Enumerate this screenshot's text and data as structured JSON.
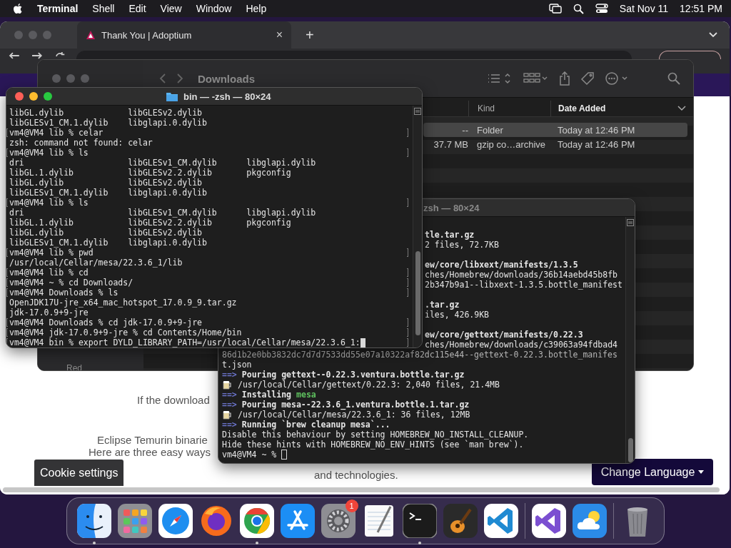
{
  "menubar": {
    "app": "Terminal",
    "menus": [
      "Shell",
      "Edit",
      "View",
      "Window",
      "Help"
    ],
    "date": "Sat Nov 11",
    "time": "12:51 PM"
  },
  "browser": {
    "tab": {
      "title": "Thank You | Adoptium",
      "close": "×",
      "selected": true
    },
    "new_tab": "+",
    "page": {
      "fragments": [
        "If the download",
        "Eclipse Temurin binarie",
        "Here are three easy ways",
        "and technologies."
      ],
      "cookie_button": "Cookie settings",
      "language_button": "Change Language"
    }
  },
  "finder": {
    "title": "Downloads",
    "sidebar": [
      "Red"
    ],
    "columns": [
      {
        "label": "Kind",
        "sorted": false
      },
      {
        "label": "Date Added",
        "sorted": true
      }
    ],
    "rows": [
      {
        "size": "--",
        "kind": "Folder",
        "date_added": "Today at 12:46 PM",
        "selected": true
      },
      {
        "size": "37.7 MB",
        "kind": "gzip co…archive",
        "date_added": "Today at 12:46 PM",
        "selected": false
      }
    ]
  },
  "terminals": [
    {
      "title": "bin — -zsh — 80×24",
      "active": true,
      "lines": [
        {
          "kind": "plain",
          "text": "libGL.dylib             libGLESv2.dylib"
        },
        {
          "kind": "plain",
          "text": "libGLESv1_CM.1.dylib    libglapi.0.dylib"
        },
        {
          "kind": "prompt",
          "text": "vm4@VM4 lib % celar"
        },
        {
          "kind": "plain",
          "text": "zsh: command not found: celar"
        },
        {
          "kind": "prompt",
          "text": "vm4@VM4 lib % ls"
        },
        {
          "kind": "plain",
          "text": "dri                     libGLESv1_CM.dylib      libglapi.dylib"
        },
        {
          "kind": "plain",
          "text": "libGL.1.dylib           libGLESv2.2.dylib       pkgconfig"
        },
        {
          "kind": "plain",
          "text": "libGL.dylib             libGLESv2.dylib"
        },
        {
          "kind": "plain",
          "text": "libGLESv1_CM.1.dylib    libglapi.0.dylib"
        },
        {
          "kind": "prompt",
          "text": "vm4@VM4 lib % ls"
        },
        {
          "kind": "plain",
          "text": "dri                     libGLESv1_CM.dylib      libglapi.dylib"
        },
        {
          "kind": "plain",
          "text": "libGL.1.dylib           libGLESv2.2.dylib       pkgconfig"
        },
        {
          "kind": "plain",
          "text": "libGL.dylib             libGLESv2.dylib"
        },
        {
          "kind": "plain",
          "text": "libGLESv1_CM.1.dylib    libglapi.0.dylib"
        },
        {
          "kind": "prompt",
          "text": "vm4@VM4 lib % pwd"
        },
        {
          "kind": "plain",
          "text": "/usr/local/Cellar/mesa/22.3.6_1/lib"
        },
        {
          "kind": "prompt",
          "text": "vm4@VM4 lib % cd"
        },
        {
          "kind": "prompt",
          "text": "vm4@VM4 ~ % cd Downloads/"
        },
        {
          "kind": "prompt",
          "text": "vm4@VM4 Downloads % ls"
        },
        {
          "kind": "plain",
          "text": "OpenJDK17U-jre_x64_mac_hotspot_17.0.9_9.tar.gz"
        },
        {
          "kind": "plain",
          "text": "jdk-17.0.9+9-jre"
        },
        {
          "kind": "prompt",
          "text": "vm4@VM4 Downloads % cd jdk-17.0.9+9-jre"
        },
        {
          "kind": "prompt",
          "text": "vm4@VM4 jdk-17.0.9+9-jre % cd Contents/Home/bin"
        },
        {
          "kind": "prompt",
          "text": "vm4@VM4 bin % export DYLD_LIBRARY_PATH=/usr/local/Cellar/mesa/22.3.6_1:",
          "cursor": true
        }
      ]
    },
    {
      "title": "zsh — 80×24",
      "active": false,
      "lines": [
        {
          "kind": "blank"
        },
        {
          "kind": "tail-bold",
          "text": "tle.tar.gz"
        },
        {
          "kind": "tail",
          "text": "2 files, 72.7KB"
        },
        {
          "kind": "blank"
        },
        {
          "kind": "tail-bold",
          "text": "ew/core/libxext/manifests/1.3.5"
        },
        {
          "kind": "tail",
          "text": "ches/Homebrew/downloads/36b14aebd45b8fb"
        },
        {
          "kind": "tail",
          "text": "2b347b9a1--libxext-1.3.5.bottle_manifest"
        },
        {
          "kind": "blank"
        },
        {
          "kind": "tail-bold",
          "text": ".tar.gz"
        },
        {
          "kind": "tail",
          "text": "iles, 426.9KB"
        },
        {
          "kind": "blank"
        },
        {
          "kind": "tail-bold",
          "text": "ew/core/gettext/manifests/0.22.3"
        },
        {
          "kind": "tail",
          "text": "ches/Homebrew/downloads/c39063a94fdbad4"
        },
        {
          "kind": "plain",
          "text": "86d1b2e0bb3832dc7d7d7533dd55e07a10322af82dc115e44--gettext-0.22.3.bottle_manifes"
        },
        {
          "kind": "plain",
          "text": "t.json"
        },
        {
          "kind": "arrow",
          "marker": "==>",
          "text": "Pouring gettext--0.22.3.ventura.bottle.tar.gz"
        },
        {
          "kind": "beer",
          "text": "/usr/local/Cellar/gettext/0.22.3: 2,040 files, 21.4MB"
        },
        {
          "kind": "arrow",
          "marker": "==>",
          "text": "Installing",
          "highlight": "mesa"
        },
        {
          "kind": "arrow",
          "marker": "==>",
          "text": "Pouring mesa--22.3.6_1.ventura.bottle.1.tar.gz"
        },
        {
          "kind": "beer",
          "text": "/usr/local/Cellar/mesa/22.3.6_1: 36 files, 12MB"
        },
        {
          "kind": "arrow",
          "marker": "==>",
          "text": "Running `brew cleanup mesa`..."
        },
        {
          "kind": "plain",
          "text": "Disable this behaviour by setting HOMEBREW_NO_INSTALL_CLEANUP."
        },
        {
          "kind": "plain",
          "text": "Hide these hints with HOMEBREW_NO_ENV_HINTS (see `man brew`)."
        },
        {
          "kind": "plain",
          "text": "vm4@VM4 ~ %",
          "cursor": true
        }
      ]
    }
  ],
  "dock": {
    "items": [
      {
        "kind": "finder",
        "running": true
      },
      {
        "kind": "launchpad",
        "running": false
      },
      {
        "kind": "safari",
        "running": false
      },
      {
        "kind": "firefox",
        "running": false
      },
      {
        "kind": "chrome",
        "running": true
      },
      {
        "kind": "appstore",
        "running": false
      },
      {
        "kind": "settings",
        "running": false,
        "badge": "1"
      },
      {
        "kind": "textedit",
        "running": false
      },
      {
        "kind": "terminal",
        "running": true
      },
      {
        "kind": "garageband",
        "running": false
      },
      {
        "kind": "vscode",
        "running": false
      },
      {
        "kind": "divider"
      },
      {
        "kind": "visualstudio",
        "running": false
      },
      {
        "kind": "weather",
        "running": false
      },
      {
        "kind": "divider"
      },
      {
        "kind": "trash",
        "running": false
      }
    ]
  }
}
